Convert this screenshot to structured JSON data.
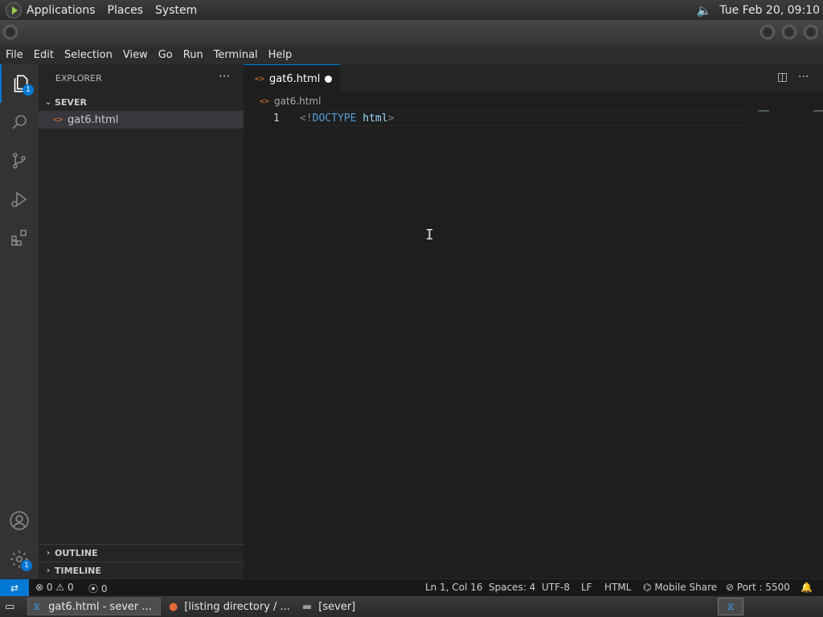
{
  "top_panel": {
    "menus": [
      "Applications",
      "Places",
      "System"
    ],
    "clock": "Tue Feb 20, 09:10"
  },
  "menubar": [
    "File",
    "Edit",
    "Selection",
    "View",
    "Go",
    "Run",
    "Terminal",
    "Help"
  ],
  "activity_bar": {
    "explorer_badge": "1",
    "settings_badge": "1"
  },
  "sidebar": {
    "title": "EXPLORER",
    "more": "···",
    "folder": "SEVER",
    "file": "gat6.html",
    "sections": [
      "OUTLINE",
      "TIMELINE"
    ]
  },
  "editor": {
    "tab_label": "gat6.html",
    "breadcrumb": "gat6.html",
    "line_number": "1",
    "code": {
      "open": "<!",
      "keyword": "DOCTYPE",
      "attr": "html",
      "close": ">"
    }
  },
  "statusbar": {
    "errors": "0",
    "warnings": "0",
    "ports": "0",
    "position": "Ln 1, Col 16",
    "spaces": "Spaces: 4",
    "encoding": "UTF-8",
    "eol": "LF",
    "language": "HTML",
    "share": "Mobile Share",
    "port": "Port : 5500"
  },
  "taskbar": {
    "tasks": [
      "gat6.html - sever ...",
      "[listing directory / ...",
      "[sever]"
    ]
  },
  "colors": {
    "accent": "#0078d4",
    "editor_bg": "#1e1e1e",
    "sidebar_bg": "#252526",
    "html_icon": "#e37933"
  }
}
